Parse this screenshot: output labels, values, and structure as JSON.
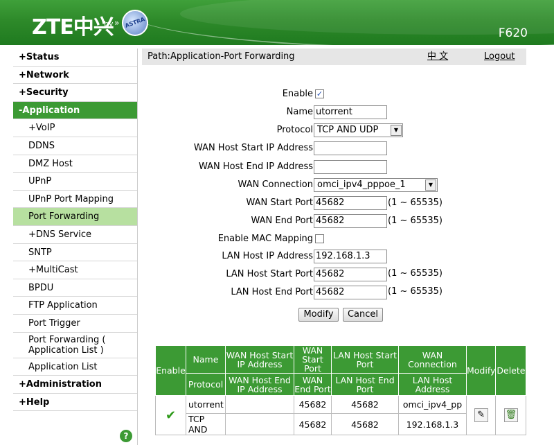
{
  "header": {
    "logo": "ZTE中兴",
    "by": "by",
    "astra": "ASTRA",
    "model": "F620"
  },
  "sidebar": {
    "items": [
      {
        "label": "+Status",
        "level": "top"
      },
      {
        "label": "+Network",
        "level": "top"
      },
      {
        "label": "+Security",
        "level": "top"
      },
      {
        "label": "-Application",
        "level": "top",
        "active": true
      },
      {
        "label": "+VoIP",
        "level": "sub"
      },
      {
        "label": "DDNS",
        "level": "sub"
      },
      {
        "label": "DMZ Host",
        "level": "sub"
      },
      {
        "label": "UPnP",
        "level": "sub"
      },
      {
        "label": "UPnP Port Mapping",
        "level": "sub"
      },
      {
        "label": "Port Forwarding",
        "level": "sub",
        "active": true
      },
      {
        "label": "+DNS Service",
        "level": "sub"
      },
      {
        "label": "SNTP",
        "level": "sub"
      },
      {
        "label": "+MultiCast",
        "level": "sub"
      },
      {
        "label": "BPDU",
        "level": "sub"
      },
      {
        "label": "FTP Application",
        "level": "sub"
      },
      {
        "label": "Port Trigger",
        "level": "sub"
      },
      {
        "label": "Port Forwarding ( Application List )",
        "level": "sub"
      },
      {
        "label": "Application List",
        "level": "sub"
      },
      {
        "label": "+Administration",
        "level": "top"
      },
      {
        "label": "+Help",
        "level": "top"
      }
    ],
    "help_icon": "?"
  },
  "pathbar": {
    "path": "Path:Application-Port Forwarding",
    "lang": "中 文",
    "logout": "Logout"
  },
  "form": {
    "enable_label": "Enable",
    "enable_checked": "✓",
    "name_label": "Name",
    "name_value": "utorrent",
    "protocol_label": "Protocol",
    "protocol_value": "TCP AND UDP",
    "wan_host_start_label": "WAN Host Start IP Address",
    "wan_host_start_value": "",
    "wan_host_end_label": "WAN Host End IP Address",
    "wan_host_end_value": "",
    "wan_conn_label": "WAN Connection",
    "wan_conn_value": "omci_ipv4_pppoe_1",
    "wan_start_port_label": "WAN Start Port",
    "wan_start_port_value": "45682",
    "wan_end_port_label": "WAN End Port",
    "wan_end_port_value": "45682",
    "mac_mapping_label": "Enable MAC Mapping",
    "lan_host_ip_label": "LAN Host IP Address",
    "lan_host_ip_value": "192.168.1.3",
    "lan_start_port_label": "LAN Host Start Port",
    "lan_start_port_value": "45682",
    "lan_end_port_label": "LAN Host End Port",
    "lan_end_port_value": "45682",
    "range_hint": "(1 ~ 65535)",
    "modify_btn": "Modify",
    "cancel_btn": "Cancel"
  },
  "table": {
    "headers": {
      "enable": "Enable",
      "name": "Name",
      "protocol": "Protocol",
      "wan_host_start": "WAN Host Start IP Address",
      "wan_host_end": "WAN Host End IP Address",
      "wan_start_port": "WAN Start Port",
      "wan_end_port": "WAN End Port",
      "lan_host_start_port": "LAN Host Start Port",
      "lan_host_end_port": "LAN Host End Port",
      "wan_connection": "WAN Connection",
      "lan_host_address": "LAN Host Address",
      "modify": "Modify",
      "delete": "Delete"
    },
    "row": {
      "enabled_mark": "✔",
      "name": "utorrent",
      "protocol": "TCP AND",
      "wan_host_start": "",
      "wan_host_end": "",
      "wan_start_port": "45682",
      "wan_end_port": "45682",
      "lan_start_port": "45682",
      "lan_end_port": "45682",
      "wan_connection": "omci_ipv4_pp",
      "lan_host_address": "192.168.1.3"
    }
  }
}
